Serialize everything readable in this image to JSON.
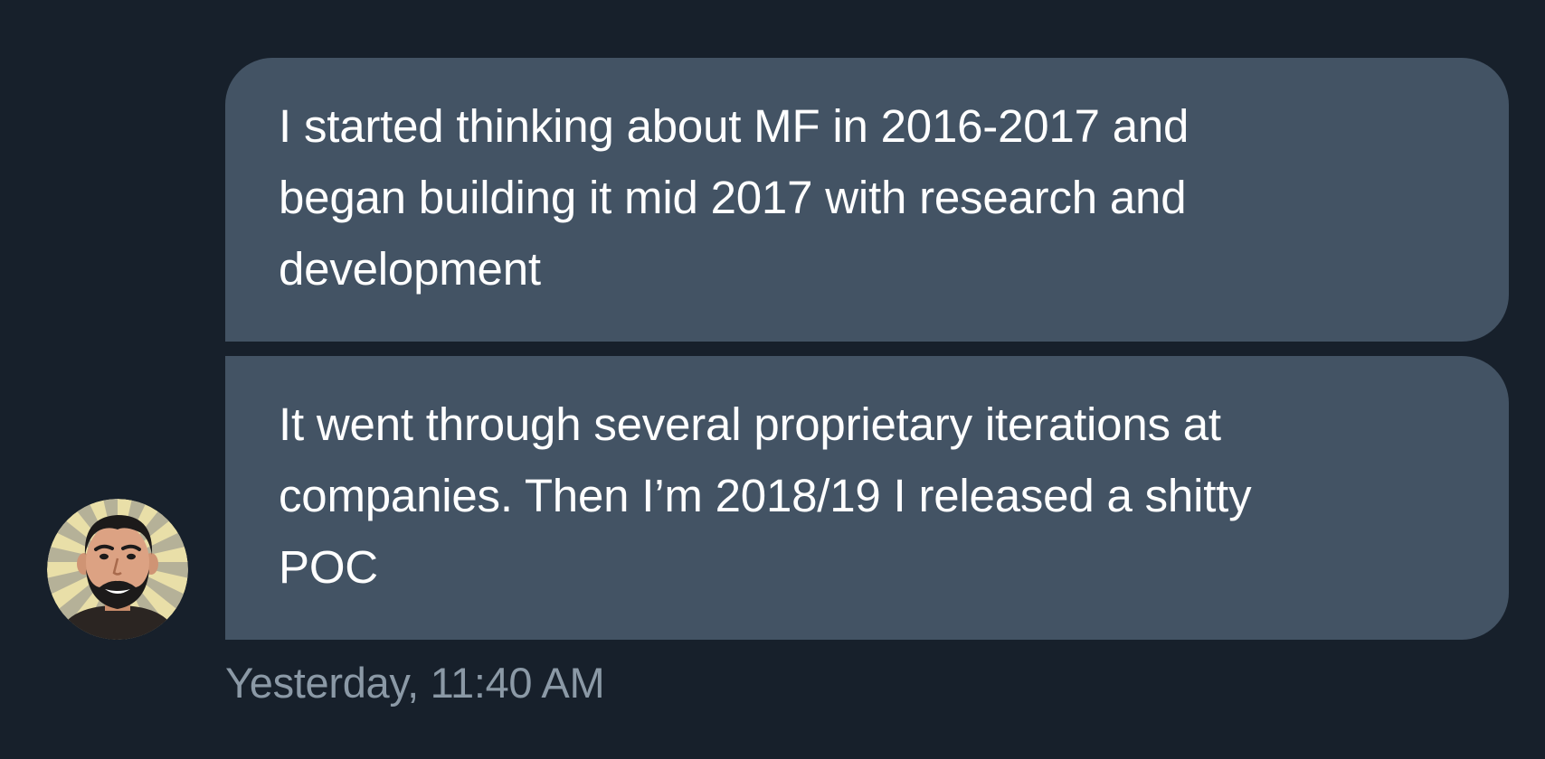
{
  "conversation": {
    "messages": [
      {
        "lines": [
          "I started thinking about MF in 2016-2017 and",
          "began building it mid 2017 with research and",
          "development"
        ]
      },
      {
        "lines": [
          "It went through several proprietary iterations at",
          "companies. Then I’m 2018/19 I released a shitty",
          "POC"
        ]
      }
    ],
    "timestamp": "Yesterday, 11:40 AM"
  },
  "colors": {
    "background": "#17202b",
    "bubble": "#435364",
    "message_text": "#ffffff",
    "timestamp_text": "#8b99a6"
  },
  "icons": {
    "avatar": "user-avatar-cartoon"
  }
}
